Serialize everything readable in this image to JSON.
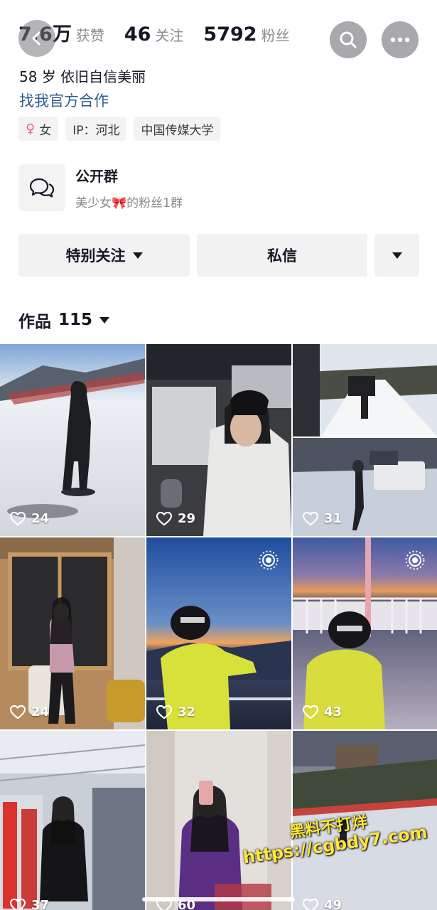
{
  "header": {
    "stats": [
      {
        "value": "7.6万",
        "label": "获赞"
      },
      {
        "value": "46",
        "label": "关注"
      },
      {
        "value": "5792",
        "label": "粉丝"
      }
    ]
  },
  "profile": {
    "bio": "58 岁 依旧自信美丽",
    "coop_link": "找我官方合作",
    "tags": {
      "gender": "女",
      "ip": "IP：河北",
      "school": "中国传媒大学"
    }
  },
  "group": {
    "title": "公开群",
    "subtitle_prefix": "美少女",
    "subtitle_suffix": "的粉丝1群"
  },
  "actions": {
    "follow": "特别关注",
    "message": "私信"
  },
  "works": {
    "label": "作品",
    "count": "115"
  },
  "posts": [
    {
      "likes": "24"
    },
    {
      "likes": "29"
    },
    {
      "likes": "31"
    },
    {
      "likes": "24"
    },
    {
      "likes": "32"
    },
    {
      "likes": "43"
    },
    {
      "likes": "37"
    },
    {
      "likes": "60"
    },
    {
      "likes": "49"
    }
  ],
  "watermark": {
    "line1": "黑料不打烊",
    "line2": "https://cgbdy7.com"
  },
  "colors": {
    "link": "#2d5b8f",
    "female": "#f25d9c",
    "watermark": "#ffe63a"
  }
}
